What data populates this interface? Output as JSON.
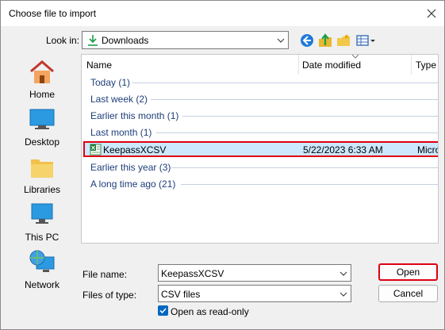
{
  "dialog": {
    "title": "Choose file to import"
  },
  "toolbar": {
    "look_in_label": "Look in:",
    "look_in_value": "Downloads"
  },
  "places": [
    {
      "label": "Home"
    },
    {
      "label": "Desktop"
    },
    {
      "label": "Libraries"
    },
    {
      "label": "This PC"
    },
    {
      "label": "Network"
    }
  ],
  "columns": {
    "name": "Name",
    "date": "Date modified",
    "type": "Type"
  },
  "groups": [
    {
      "label": "Today (1)"
    },
    {
      "label": "Last week (2)"
    },
    {
      "label": "Earlier this month (1)"
    },
    {
      "label": "Last month (1)"
    },
    {
      "label": "Earlier this year (3)"
    },
    {
      "label": "A long time ago (21)"
    }
  ],
  "selected_file": {
    "name": "KeepassXCSV",
    "date": "5/22/2023 6:33 AM",
    "type": "Micro"
  },
  "form": {
    "file_name_label": "File name:",
    "file_name_value": "KeepassXCSV",
    "files_of_type_label": "Files of type:",
    "files_of_type_value": "CSV files",
    "readonly_label": "Open as read-only",
    "readonly_checked": true
  },
  "buttons": {
    "open": "Open",
    "cancel": "Cancel"
  },
  "colors": {
    "accent": "#0067c0",
    "group_text": "#1e3e7a",
    "selection": "#cce8ff",
    "highlight_border": "#e00010"
  }
}
